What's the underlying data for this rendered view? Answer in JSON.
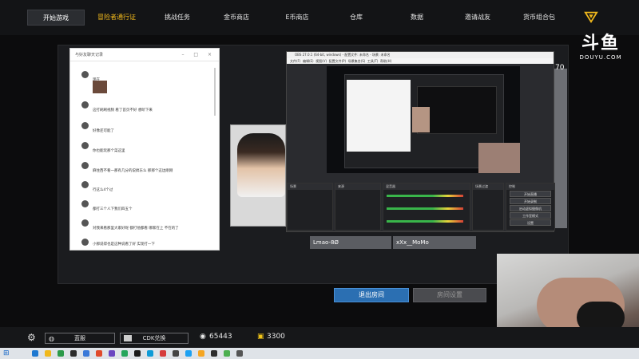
{
  "nav": {
    "tabs": [
      {
        "label": "开始游戏",
        "active": true,
        "highlight": false
      },
      {
        "label": "冒险者通行证",
        "active": false,
        "highlight": true
      },
      {
        "label": "挑战任务",
        "active": false,
        "highlight": false
      },
      {
        "label": "金币商店",
        "active": false,
        "highlight": false
      },
      {
        "label": "E币商店",
        "active": false,
        "highlight": false
      },
      {
        "label": "仓库",
        "active": false,
        "highlight": false
      },
      {
        "label": "数据",
        "active": false,
        "highlight": false
      },
      {
        "label": "邀请战友",
        "active": false,
        "highlight": false
      },
      {
        "label": "货币组合包",
        "active": false,
        "highlight": false
      }
    ],
    "accent": "#f0b81c"
  },
  "watermark": {
    "brand": "斗鱼",
    "domain": "DOUYU.COM"
  },
  "game": {
    "number": "70",
    "players": [
      "Lmao-8Ø",
      "xXx__MoMo"
    ],
    "exit_button": "退出房间",
    "settings_button": "房间设置"
  },
  "chat": {
    "title": "与好友聊天记录",
    "messages": [
      {
        "text": "现在"
      },
      {
        "text": "这打刷刷视频 看了首页不好 想听下来"
      },
      {
        "text": "好像还可能了"
      },
      {
        "text": "你也能玩那个菜这里"
      },
      {
        "text": "麻住西不看一那有几分的说搞东么 那那个这边刚刚"
      },
      {
        "text": "行这么4个过"
      },
      {
        "text": "都打三个人下我们四五个"
      },
      {
        "text": "对我来看那里大家好呢 都打他都看 哪家在上 不在的了"
      },
      {
        "text": "小那说得也是这种说看了好 实现打一下"
      }
    ]
  },
  "obs": {
    "title": "OBS 27.0.1 (64-bit, windows) - 配置文件: 未命名 - 场景: 未命名",
    "menu": [
      "文件(F)",
      "编辑(E)",
      "视图(V)",
      "配置文件(P)",
      "场景集合(S)",
      "工具(T)",
      "帮助(H)"
    ],
    "docks": {
      "scenes": "场景",
      "sources": "来源",
      "mixer": "混音器",
      "transitions": "场景过渡",
      "controls": "控制"
    },
    "controls": [
      "开始直播",
      "开始录制",
      "启动虚拟摄像机",
      "工作室模式",
      "设置",
      "退出"
    ]
  },
  "bottombar": {
    "left_button": "蓝服",
    "cdk_button": "CDK兑换",
    "coins": "65443",
    "ecoins": "3300"
  }
}
